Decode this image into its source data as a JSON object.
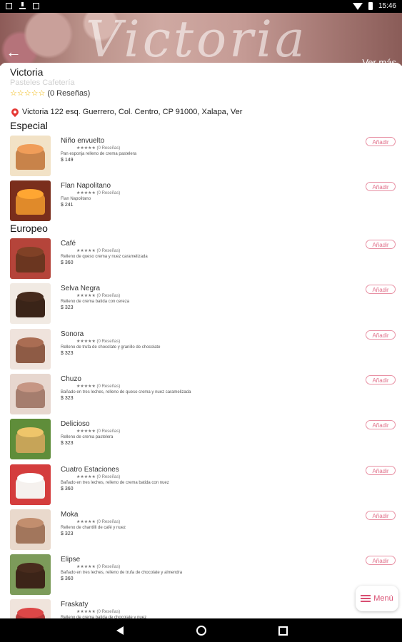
{
  "status_bar": {
    "time": "15:46"
  },
  "header": {
    "hero_text": "Victoria",
    "more_label": "Ver más"
  },
  "store": {
    "name": "Victoria",
    "category": "Pasteles Cafetería",
    "stars": "☆☆☆☆☆",
    "reviews": "(0 Reseñas)",
    "address": "Victoria 122 esq. Guerrero, Col. Centro, CP 91000, Xalapa, Ver"
  },
  "sections": [
    {
      "title": "Especial",
      "items": [
        {
          "name": "Niño envuelto",
          "rating": "★★★★★ (0 Reseñas)",
          "desc": "Pan esponja relleno de crema pastelera",
          "price": "$ 149",
          "add": "Añadir",
          "colors": [
            "#c8834a",
            "#f2e2c6"
          ]
        },
        {
          "name": "Flan Napolitano",
          "rating": "★★★★★ (0 Reseñas)",
          "desc": "Flan Napolitano",
          "price": "$ 241",
          "add": "Añadir",
          "colors": [
            "#e08a2a",
            "#7a2e1c"
          ]
        }
      ]
    },
    {
      "title": "Europeo",
      "items": [
        {
          "name": "Café",
          "rating": "★★★★★ (0 Reseñas)",
          "desc": "Relleno de queso crema y nuez caramelizada",
          "price": "$ 360",
          "add": "Añadir",
          "colors": [
            "#6b3620",
            "#b5443a"
          ]
        },
        {
          "name": "Selva Negra",
          "rating": "★★★★★ (0 Reseñas)",
          "desc": "Relleno de crema batida con cereza",
          "price": "$ 323",
          "add": "Añadir",
          "colors": [
            "#3a2418",
            "#f1eae3"
          ]
        },
        {
          "name": "Sonora",
          "rating": "★★★★★ (0 Reseñas)",
          "desc": "Relleno de trufa de chocolate y granillo de chocolate",
          "price": "$ 323",
          "add": "Añadir",
          "colors": [
            "#8e5b45",
            "#efe3dc"
          ]
        },
        {
          "name": "Chuzo",
          "rating": "★★★★★ (0 Reseñas)",
          "desc": "Bañado en tres leches, relleno de queso crema y nuez caramelizada",
          "price": "$ 323",
          "add": "Añadir",
          "colors": [
            "#a57d6e",
            "#e7d7cf"
          ]
        },
        {
          "name": "Delicioso",
          "rating": "★★★★★ (0 Reseñas)",
          "desc": "Relleno de crema pastelera",
          "price": "$ 323",
          "add": "Añadir",
          "colors": [
            "#c6a458",
            "#5f8d3a"
          ]
        },
        {
          "name": "Cuatro Estaciones",
          "rating": "★★★★★ (0 Reseñas)",
          "desc": "Bañado en tres leches, relleno de crema batida con nuez",
          "price": "$ 360",
          "add": "Añadir",
          "colors": [
            "#f5f1ee",
            "#d43d3d"
          ]
        },
        {
          "name": "Moka",
          "rating": "★★★★★ (0 Reseñas)",
          "desc": "Relleno de chantilli de café y nuez",
          "price": "$ 323",
          "add": "Añadir",
          "colors": [
            "#a2765c",
            "#e9d9cc"
          ]
        },
        {
          "name": "Elipse",
          "rating": "★★★★★ (0 Reseñas)",
          "desc": "Bañado en tres leches, relleno de trufa de chocolate y almendra",
          "price": "$ 360",
          "add": "Añadir",
          "colors": [
            "#3c2418",
            "#7c9b5a"
          ]
        },
        {
          "name": "Fraskaty",
          "rating": "★★★★★ (0 Reseñas)",
          "desc": "Relleno de crema batida de chocolate y nuez",
          "price": "",
          "add": "Añadir",
          "colors": [
            "#b83b3b",
            "#f0e4dc"
          ]
        }
      ]
    }
  ],
  "fab": {
    "label": "Menú"
  }
}
